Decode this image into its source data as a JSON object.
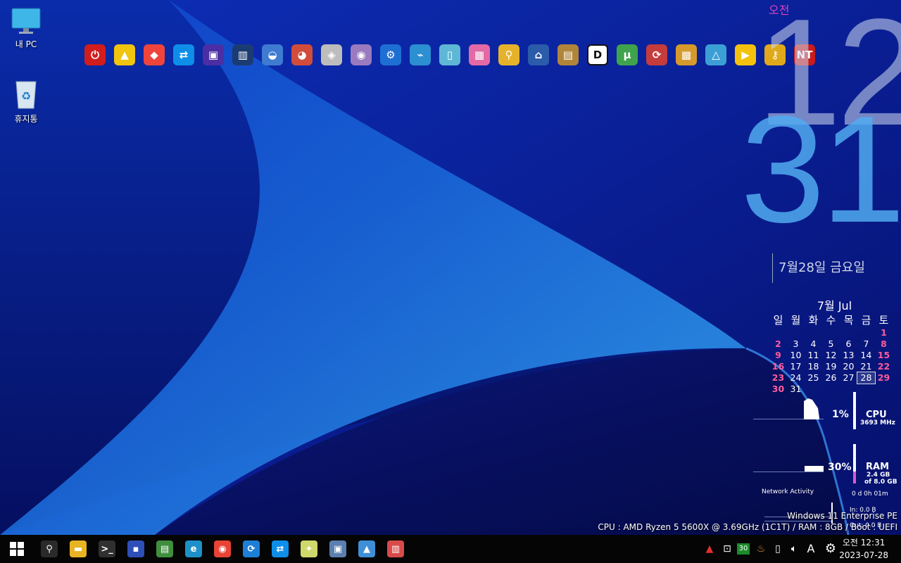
{
  "desktop": {
    "icons": [
      {
        "name": "this-pc-icon",
        "label": "내 PC"
      },
      {
        "name": "recycle-bin-icon",
        "label": "휴지통"
      }
    ]
  },
  "launcher": [
    {
      "name": "power-icon",
      "color": "#d21d1d",
      "glyph": "⏻"
    },
    {
      "name": "aimp-icon",
      "color": "#f1c40f",
      "glyph": "▲"
    },
    {
      "name": "anydesk-icon",
      "color": "#ef443b",
      "glyph": "◆"
    },
    {
      "name": "teamviewer-icon",
      "color": "#0e8ee9",
      "glyph": "⇄"
    },
    {
      "name": "cpu-z-icon",
      "color": "#4b2ea3",
      "glyph": "▣"
    },
    {
      "name": "hwinfo-icon",
      "color": "#1b3c72",
      "glyph": "▥"
    },
    {
      "name": "disk-tool-icon",
      "color": "#3f7bd0",
      "glyph": "◒"
    },
    {
      "name": "partition-icon",
      "color": "#d24c3b",
      "glyph": "◕"
    },
    {
      "name": "ghost-icon",
      "color": "#bdbdbd",
      "glyph": "◈"
    },
    {
      "name": "disc-burn-icon",
      "color": "#9a7bc0",
      "glyph": "◉"
    },
    {
      "name": "settings-gears-icon",
      "color": "#1e6fd4",
      "glyph": "⚙"
    },
    {
      "name": "network-tool-icon",
      "color": "#2b8fd1",
      "glyph": "⌁"
    },
    {
      "name": "notepad-icon",
      "color": "#5fb7d6",
      "glyph": "▯"
    },
    {
      "name": "windows-store-icon",
      "color": "#e46aa6",
      "glyph": "▦"
    },
    {
      "name": "search-user-icon",
      "color": "#e7b22b",
      "glyph": "⚲"
    },
    {
      "name": "remote-user-icon",
      "color": "#2a5caa",
      "glyph": "⌂"
    },
    {
      "name": "archive-box-icon",
      "color": "#b0853a",
      "glyph": "▤"
    },
    {
      "name": "d-app-icon",
      "color": "#ffffff",
      "glyph": "D"
    },
    {
      "name": "utorrent-icon",
      "color": "#3fa34d",
      "glyph": "μ"
    },
    {
      "name": "backup-restore-icon",
      "color": "#c63b3b",
      "glyph": "⟳"
    },
    {
      "name": "package-icon",
      "color": "#d59a2b",
      "glyph": "▩"
    },
    {
      "name": "triangle-app-icon",
      "color": "#3b9fd6",
      "glyph": "△"
    },
    {
      "name": "media-player-icon",
      "color": "#f4c20d",
      "glyph": "▶"
    },
    {
      "name": "key-icon",
      "color": "#e0a91c",
      "glyph": "⚷"
    },
    {
      "name": "nt-password-icon",
      "color": "#c81c1c",
      "glyph": "NT"
    }
  ],
  "clock": {
    "ampm": "오전",
    "hour": "12",
    "minute": "31",
    "date_text": "7월28일   금요일"
  },
  "calendar": {
    "title": "7월 Jul",
    "weekdays": [
      "일",
      "월",
      "화",
      "수",
      "목",
      "금",
      "토"
    ],
    "first_weekday_index": 6,
    "days_in_month": 31,
    "today": 28,
    "red_days": [
      1,
      2,
      8,
      9,
      15,
      16,
      22,
      23,
      29,
      30
    ]
  },
  "meters": {
    "cpu": {
      "percent_text": "1%",
      "title": "CPU",
      "sub": "3693 MHz"
    },
    "ram": {
      "percent_text": "30%",
      "title": "RAM",
      "sub1": "2.4 GB",
      "sub2": "of 8.0 GB"
    },
    "uptime": "0 d 0h 01m",
    "network": {
      "title": "Network Activity",
      "in": "In: 0.0 B",
      "out": "Out: 0.0 B"
    }
  },
  "os_info": {
    "line1": "Windows 11 Enterprise PE",
    "line2": "CPU : AMD Ryzen 5 5600X @ 3.69GHz (1C1T) / RAM : 8GB / Boot : UEFI"
  },
  "taskbar": {
    "apps": [
      {
        "name": "search-icon",
        "color": "#2a2a2a",
        "glyph": "⚲"
      },
      {
        "name": "file-explorer-icon",
        "color": "#e8b424",
        "glyph": "▬"
      },
      {
        "name": "command-prompt-icon",
        "color": "#303030",
        "glyph": ">_"
      },
      {
        "name": "save-disk-icon",
        "color": "#2e4fb8",
        "glyph": "▪"
      },
      {
        "name": "network-card-icon",
        "color": "#3f8f3f",
        "glyph": "▤"
      },
      {
        "name": "edge-icon",
        "color": "#1e90c8",
        "glyph": "e"
      },
      {
        "name": "chrome-icon",
        "color": "#e84335",
        "glyph": "◉"
      },
      {
        "name": "sync-icon",
        "color": "#1d7fd6",
        "glyph": "⟳"
      },
      {
        "name": "teamviewer-icon",
        "color": "#0e8ee9",
        "glyph": "⇄"
      },
      {
        "name": "cleaner-icon",
        "color": "#cfd86b",
        "glyph": "✦"
      },
      {
        "name": "network-share-icon",
        "color": "#5b7fb0",
        "glyph": "▣"
      },
      {
        "name": "photo-viewer-icon",
        "color": "#3f8fd6",
        "glyph": "▲"
      },
      {
        "name": "task-manager-icon",
        "color": "#d84a4a",
        "glyph": "▥"
      }
    ],
    "tray": {
      "badge_number": "30",
      "ime_label": "A",
      "time": "오전 12:31",
      "date": "2023-07-28"
    }
  }
}
